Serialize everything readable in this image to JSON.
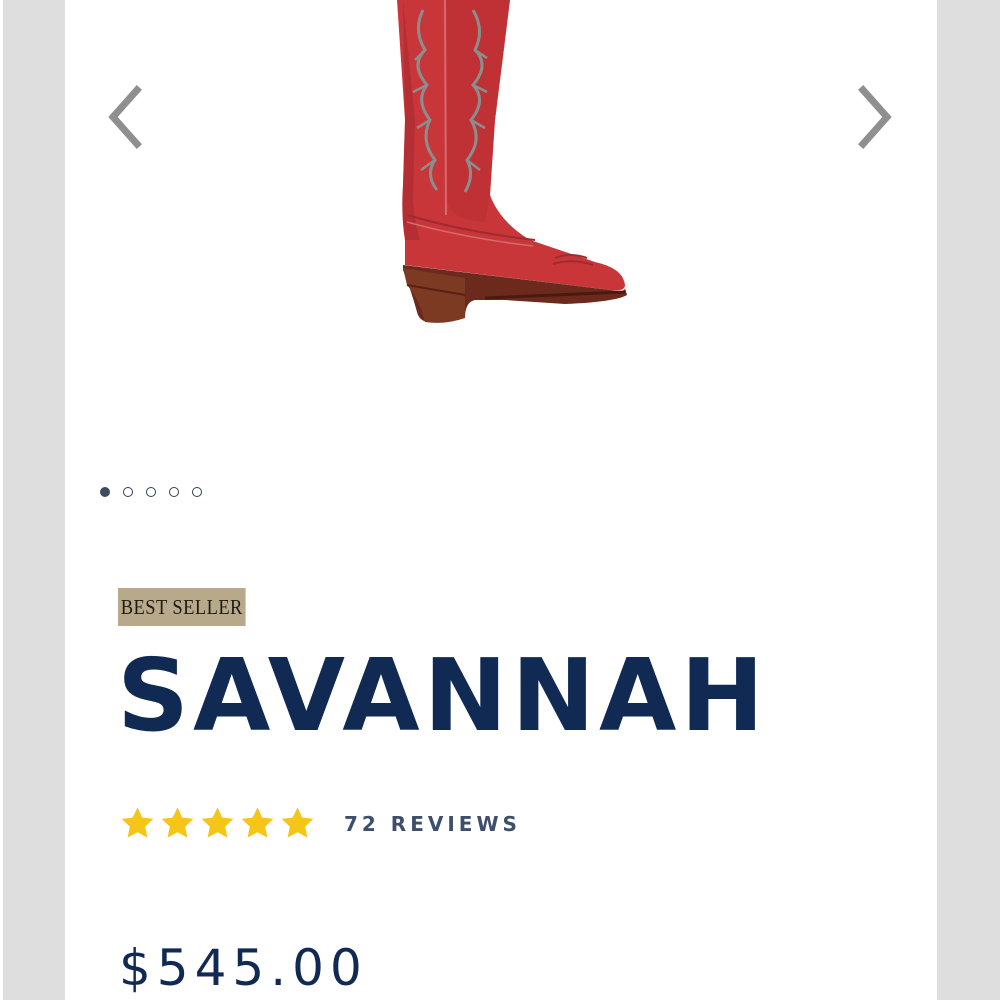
{
  "product": {
    "badge": "BEST SELLER",
    "name": "SAVANNAH",
    "rating_stars": 5,
    "reviews_label": "72 REVIEWS",
    "price": "$545.00",
    "image": "red-cowboy-boot",
    "boot_color": "#c8363a"
  },
  "gallery": {
    "prev_icon": "chevron-left-icon",
    "next_icon": "chevron-right-icon",
    "slide_count": 5,
    "active_slide": 1
  },
  "colors": {
    "title": "#102a54",
    "badge_bg": "#b8a98a",
    "star": "#f5c518",
    "reviews": "#3d4f6b"
  }
}
